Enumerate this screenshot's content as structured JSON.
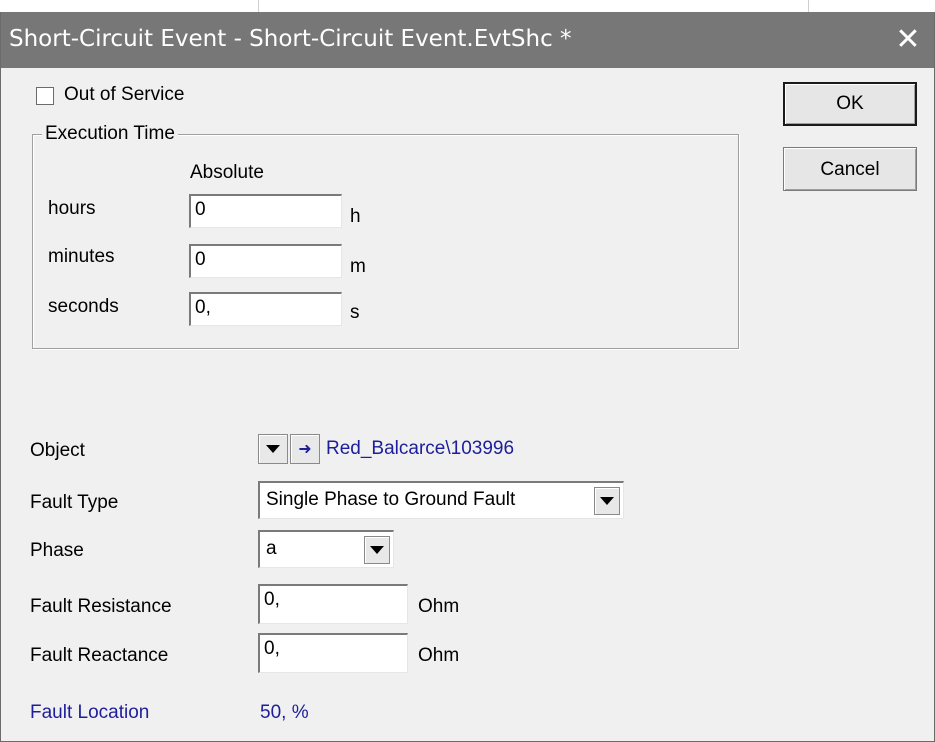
{
  "window": {
    "title": "Short-Circuit Event - Short-Circuit Event.EvtShc *",
    "close_glyph": "✕"
  },
  "out_of_service": {
    "label": "Out of Service",
    "checked": false
  },
  "buttons": {
    "ok": "OK",
    "cancel": "Cancel"
  },
  "execution_time": {
    "group_label": "Execution Time",
    "column_header": "Absolute",
    "rows": [
      {
        "label": "hours",
        "value": "0",
        "unit": "h"
      },
      {
        "label": "minutes",
        "value": "0",
        "unit": "m"
      },
      {
        "label": "seconds",
        "value": "0,",
        "unit": "s"
      }
    ]
  },
  "object": {
    "label": "Object",
    "icons": [
      "down-triangle-icon",
      "right-arrow-icon"
    ],
    "value": "Red_Balcarce\\103996"
  },
  "fault_type": {
    "label": "Fault Type",
    "value": "Single Phase to Ground Fault"
  },
  "phase": {
    "label": "Phase",
    "value": "a"
  },
  "fault_resistance": {
    "label": "Fault Resistance",
    "value": "0,",
    "unit": "Ohm"
  },
  "fault_reactance": {
    "label": "Fault Reactance",
    "value": "0,",
    "unit": "Ohm"
  },
  "fault_location": {
    "label": "Fault Location",
    "value": "50, %"
  },
  "colors": {
    "title_bar": "#777777",
    "link_blue": "#1d1e9a",
    "dialog_bg": "#f0f0f0"
  }
}
